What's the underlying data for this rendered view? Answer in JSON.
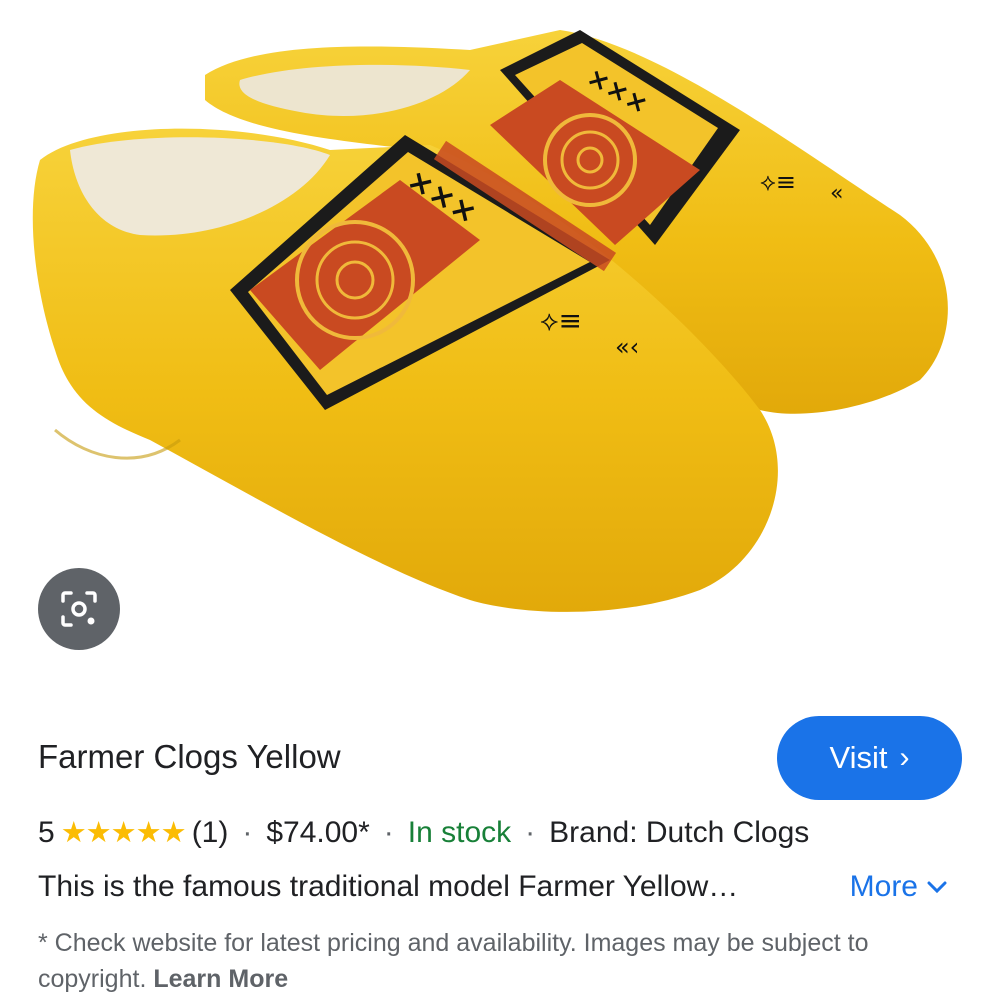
{
  "product": {
    "title": "Farmer Clogs Yellow",
    "visit_label": "Visit",
    "rating_value": "5",
    "stars": "★★★★★",
    "review_count": "(1)",
    "price": "$74.00*",
    "stock_status": "In stock",
    "brand": "Brand: Dutch Clogs",
    "description": "This is the famous traditional model Farmer Yellow…",
    "more_label": "More",
    "disclaimer": "* Check website for latest pricing and availability. Images may be subject to copyright.",
    "learn_more_label": "Learn More"
  },
  "icons": {
    "lens": "google-lens-icon",
    "visit_chevron": "chevron-right-icon",
    "more_chevron": "chevron-down-icon"
  },
  "colors": {
    "visit_button": "#1a73e8",
    "stock_green": "#188038",
    "star_yellow": "#fbbc04",
    "clog_yellow": "#f2c21b"
  }
}
